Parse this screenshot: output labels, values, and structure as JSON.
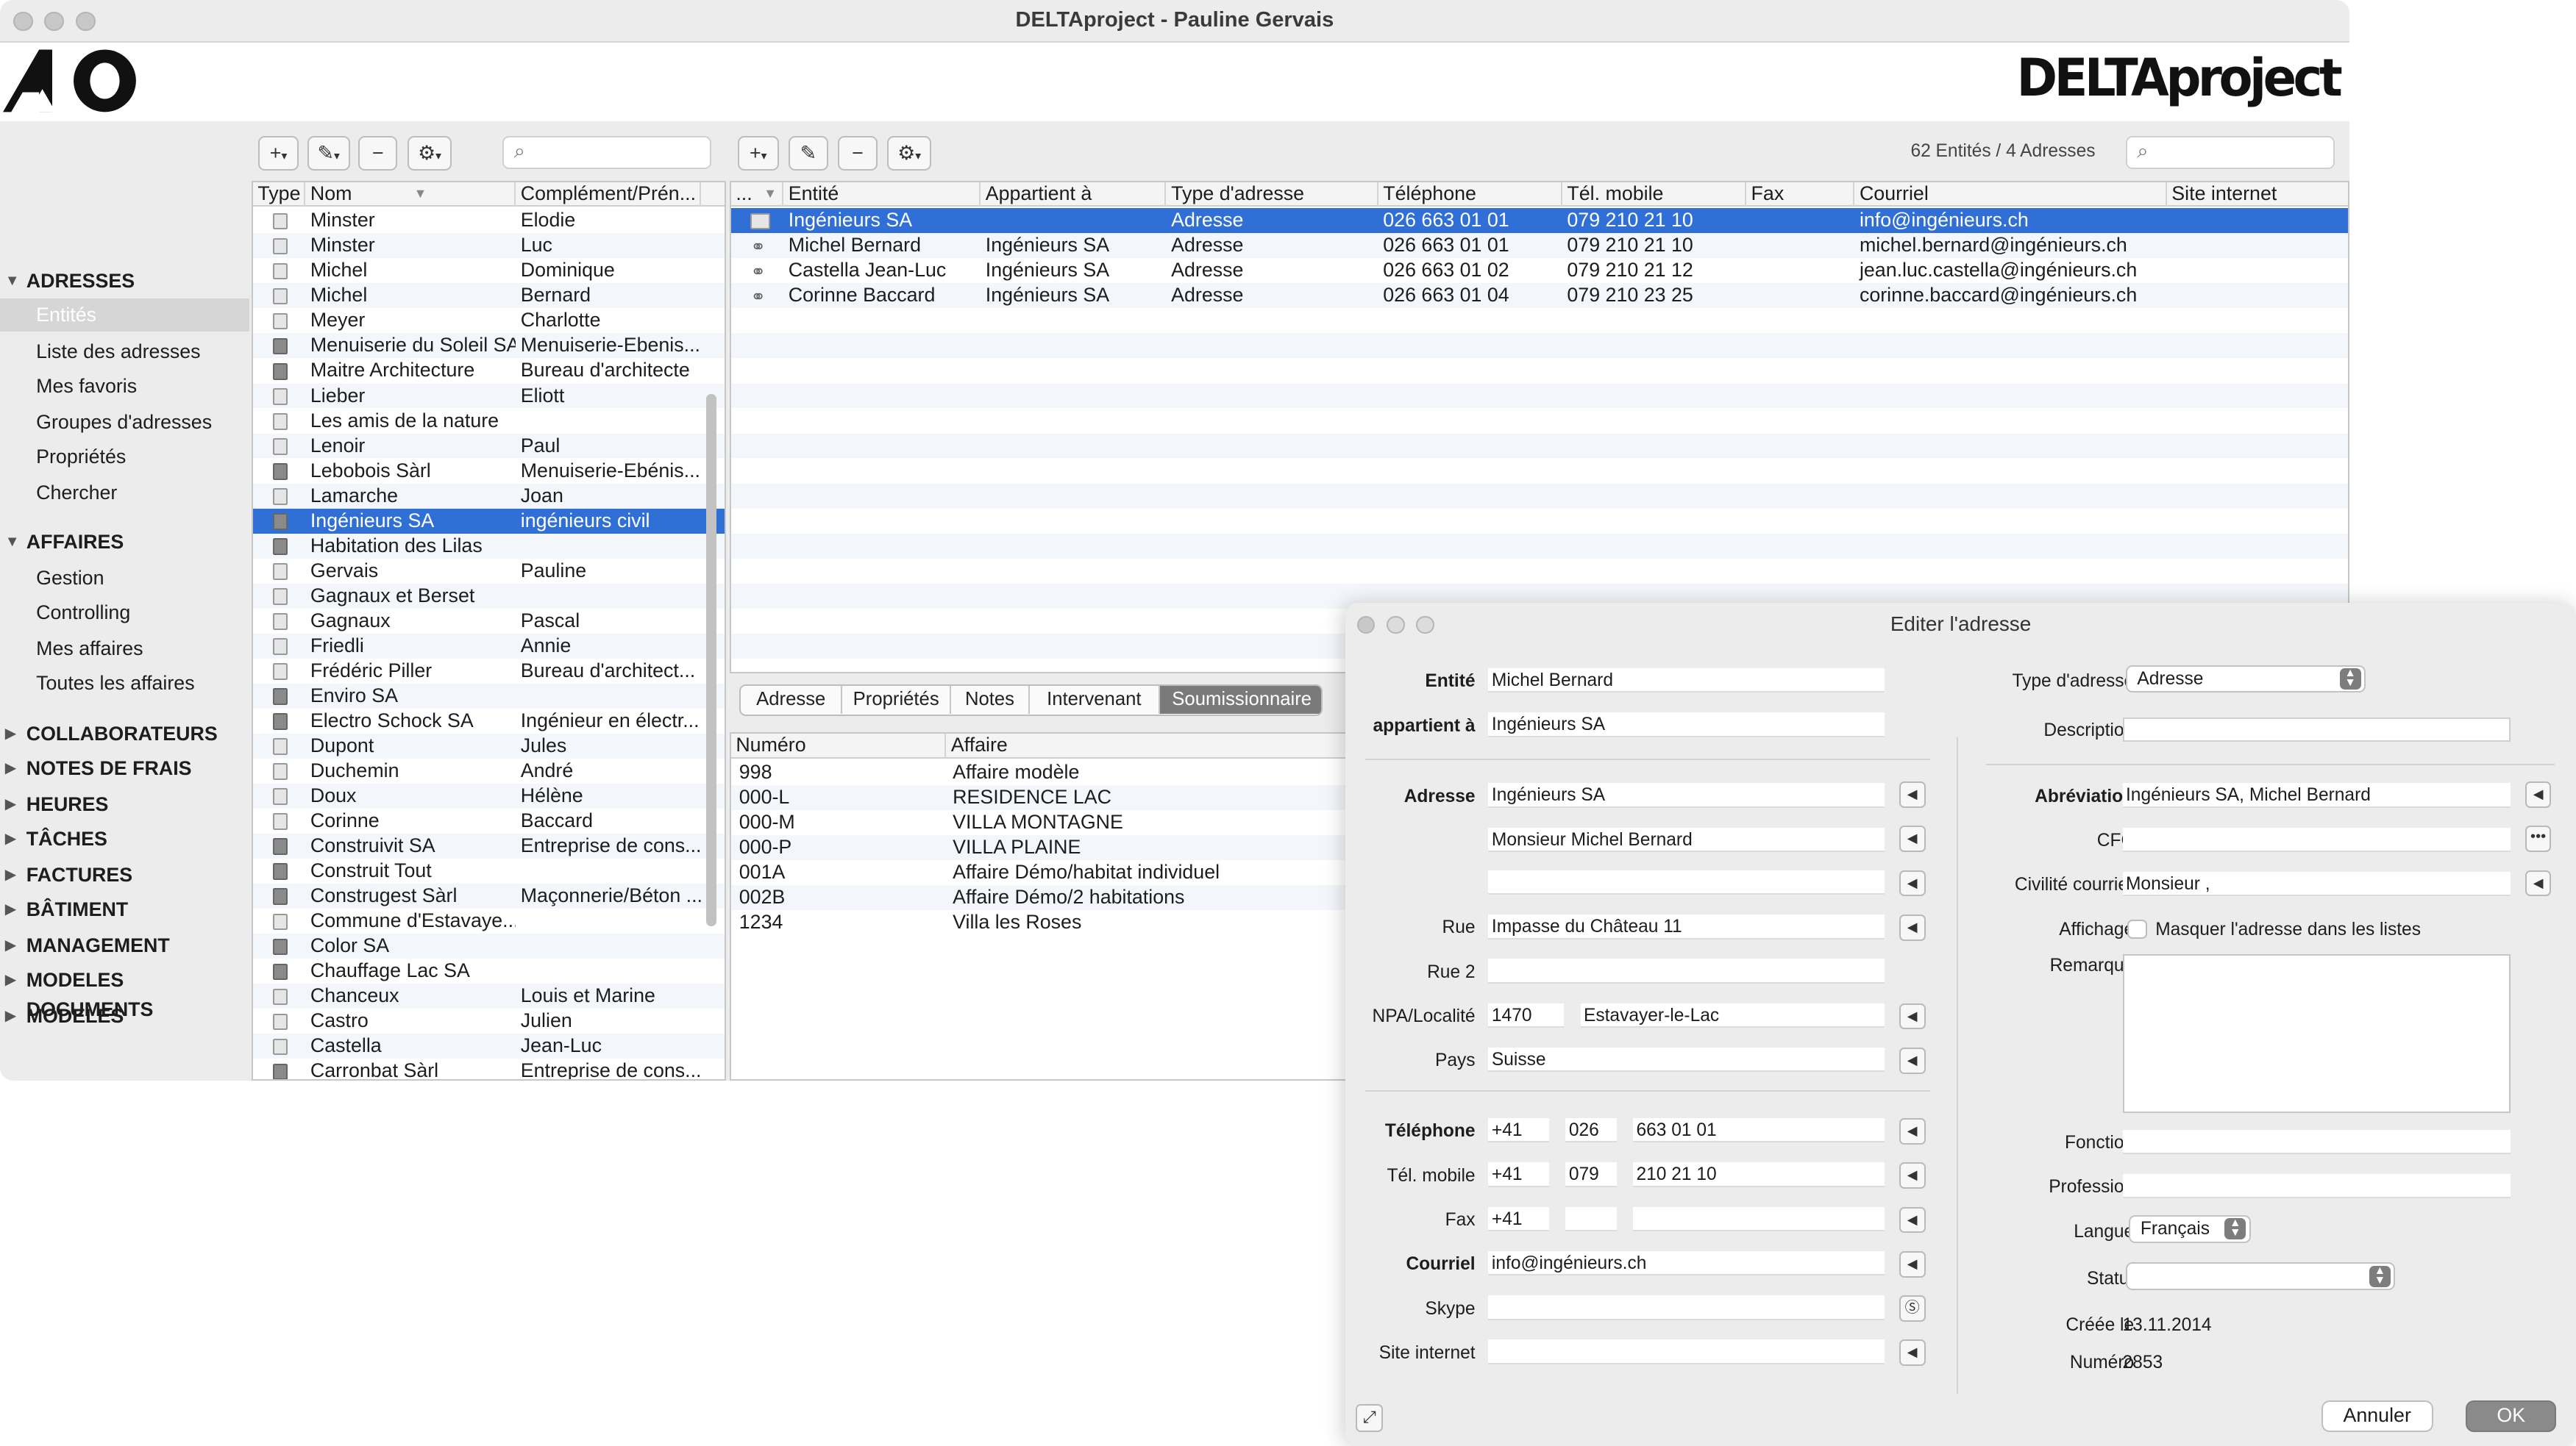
{
  "window": {
    "title": "DELTAproject - Pauline Gervais",
    "brand_right": "DELTAproject"
  },
  "toolbar": {
    "counts": "62 Entités / 4 Adresses",
    "add": "+",
    "edit": "✎",
    "remove": "−",
    "gear": "⚙"
  },
  "sidebar": {
    "adresses": "ADRESSES",
    "adresses_items": [
      "Entités",
      "Liste des adresses",
      "Mes favoris",
      "Groupes d'adresses",
      "Propriétés",
      "Chercher"
    ],
    "affaires": "AFFAIRES",
    "affaires_items": [
      "Gestion",
      "Controlling",
      "Mes affaires",
      "Toutes les affaires"
    ],
    "collapsed": [
      "COLLABORATEURS",
      "NOTES DE FRAIS",
      "HEURES",
      "TÂCHES",
      "FACTURES",
      "BÂTIMENT",
      "MANAGEMENT",
      "MODELES DOCUMENTS",
      "MODELES"
    ]
  },
  "entities": {
    "columns": [
      "Type",
      "Nom",
      "Complément/Prén..."
    ],
    "rows": [
      {
        "type": "person",
        "nom": "Minster",
        "comp": "Elodie"
      },
      {
        "type": "person",
        "nom": "Minster",
        "comp": "Luc"
      },
      {
        "type": "person",
        "nom": "Michel",
        "comp": "Dominique"
      },
      {
        "type": "person",
        "nom": "Michel",
        "comp": "Bernard"
      },
      {
        "type": "person",
        "nom": "Meyer",
        "comp": "Charlotte"
      },
      {
        "type": "company",
        "nom": "Menuiserie du Soleil SA",
        "comp": "Menuiserie-Ebenis..."
      },
      {
        "type": "company",
        "nom": "Maitre Architecture",
        "comp": "Bureau d'architecte"
      },
      {
        "type": "person",
        "nom": "Lieber",
        "comp": "Eliott"
      },
      {
        "type": "group",
        "nom": "Les amis de la nature",
        "comp": ""
      },
      {
        "type": "person",
        "nom": "Lenoir",
        "comp": "Paul"
      },
      {
        "type": "company",
        "nom": "Lebobois Sàrl",
        "comp": "Menuiserie-Ebénis..."
      },
      {
        "type": "person",
        "nom": "Lamarche",
        "comp": "Joan"
      },
      {
        "type": "company",
        "nom": "Ingénieurs SA",
        "comp": "ingénieurs civil"
      },
      {
        "type": "company",
        "nom": "Habitation des Lilas",
        "comp": ""
      },
      {
        "type": "person",
        "nom": "Gervais",
        "comp": "Pauline"
      },
      {
        "type": "group",
        "nom": "Gagnaux et Berset",
        "comp": ""
      },
      {
        "type": "person",
        "nom": "Gagnaux",
        "comp": "Pascal"
      },
      {
        "type": "person",
        "nom": "Friedli",
        "comp": "Annie"
      },
      {
        "type": "person",
        "nom": "Frédéric Piller",
        "comp": "Bureau d'architect..."
      },
      {
        "type": "company",
        "nom": "Enviro SA",
        "comp": ""
      },
      {
        "type": "company",
        "nom": "Electro Schock SA",
        "comp": "Ingénieur en électr..."
      },
      {
        "type": "person",
        "nom": "Dupont",
        "comp": "Jules"
      },
      {
        "type": "person",
        "nom": "Duchemin",
        "comp": "André"
      },
      {
        "type": "person",
        "nom": "Doux",
        "comp": "Hélène"
      },
      {
        "type": "person",
        "nom": "Corinne",
        "comp": "Baccard"
      },
      {
        "type": "company",
        "nom": "Construivit SA",
        "comp": "Entreprise de cons..."
      },
      {
        "type": "company",
        "nom": "Construit Tout",
        "comp": ""
      },
      {
        "type": "company",
        "nom": "Construgest Sàrl",
        "comp": "Maçonnerie/Béton ..."
      },
      {
        "type": "group",
        "nom": "Commune d'Estavaye...",
        "comp": ""
      },
      {
        "type": "company",
        "nom": "Color SA",
        "comp": ""
      },
      {
        "type": "company",
        "nom": "Chauffage Lac SA",
        "comp": ""
      },
      {
        "type": "group",
        "nom": "Chanceux",
        "comp": "Louis et Marine"
      },
      {
        "type": "person",
        "nom": "Castro",
        "comp": "Julien"
      },
      {
        "type": "person",
        "nom": "Castella",
        "comp": "Jean-Luc"
      },
      {
        "type": "company",
        "nom": "Carronbat Sàrl",
        "comp": "Entreprise de cons..."
      }
    ]
  },
  "addresses": {
    "columns": [
      "...",
      "Entité",
      "Appartient à",
      "Type d'adresse",
      "Téléphone",
      "Tél. mobile",
      "Fax",
      "Courriel",
      "Site internet"
    ],
    "rows": [
      {
        "entite": "Ingénieurs SA",
        "appartient": "",
        "type": "Adresse",
        "tel": "026 663 01 01",
        "mobile": "079 210 21 10",
        "fax": "",
        "courriel": "info@ingénieurs.ch",
        "site": ""
      },
      {
        "entite": "Michel Bernard",
        "appartient": "Ingénieurs SA",
        "type": "Adresse",
        "tel": "026 663 01 01",
        "mobile": "079 210 21 10",
        "fax": "",
        "courriel": "michel.bernard@ingénieurs.ch",
        "site": ""
      },
      {
        "entite": "Castella Jean-Luc",
        "appartient": "Ingénieurs SA",
        "type": "Adresse",
        "tel": "026 663 01 02",
        "mobile": "079 210 21 12",
        "fax": "",
        "courriel": "jean.luc.castella@ingénieurs.ch",
        "site": ""
      },
      {
        "entite": "Corinne Baccard",
        "appartient": "Ingénieurs SA",
        "type": "Adresse",
        "tel": "026 663 01 04",
        "mobile": "079 210 23 25",
        "fax": "",
        "courriel": "corinne.baccard@ingénieurs.ch",
        "site": ""
      }
    ]
  },
  "tabs": [
    "Adresse",
    "Propriétés",
    "Notes",
    "Intervenant",
    "Soumissionnaire"
  ],
  "affaires_table": {
    "columns": [
      "Numéro",
      "Affaire"
    ],
    "rows": [
      {
        "num": "998",
        "affaire": "Affaire modèle"
      },
      {
        "num": "000-L",
        "affaire": "RESIDENCE LAC"
      },
      {
        "num": "000-M",
        "affaire": "VILLA MONTAGNE"
      },
      {
        "num": "000-P",
        "affaire": "VILLA PLAINE"
      },
      {
        "num": "001A",
        "affaire": "Affaire Démo/habitat individuel"
      },
      {
        "num": "002B",
        "affaire": "Affaire Démo/2 habitations"
      },
      {
        "num": "1234",
        "affaire": "Villa les Roses"
      }
    ]
  },
  "dialog": {
    "title": "Editer l'adresse",
    "labels": {
      "entite": "Entité",
      "appartient": "appartient à",
      "adresse": "Adresse",
      "rue": "Rue",
      "rue2": "Rue 2",
      "npa": "NPA/Localité",
      "pays": "Pays",
      "telephone": "Téléphone",
      "mobile": "Tél. mobile",
      "fax": "Fax",
      "courriel": "Courriel",
      "skype": "Skype",
      "site": "Site internet",
      "type_adresse": "Type d'adresse",
      "description": "Description",
      "abreviation": "Abréviation",
      "cfc": "CFC",
      "civilite": "Civilité courrier",
      "affichage": "Affichage",
      "remarque": "Remarque",
      "fonction": "Fonction",
      "profession": "Profession",
      "langue": "Langue",
      "statut": "Statut",
      "creee": "Créée le",
      "numero": "Numéro"
    },
    "values": {
      "entite": "Michel Bernard",
      "appartient": "Ingénieurs SA",
      "adresse1": "Ingénieurs SA",
      "adresse2": "Monsieur Michel Bernard",
      "adresse3": "",
      "rue": "Impasse du Château 11",
      "rue2": "",
      "npa": "1470",
      "localite": "Estavayer-le-Lac",
      "pays": "Suisse",
      "tel_cc": "+41",
      "tel_area": "026",
      "tel_num": "663 01 01",
      "mob_cc": "+41",
      "mob_area": "079",
      "mob_num": "210 21 10",
      "fax_cc": "+41",
      "fax_area": "",
      "fax_num": "",
      "courriel": "info@ingénieurs.ch",
      "skype": "",
      "site": "",
      "type_adresse": "Adresse",
      "description": "",
      "abreviation": "Ingénieurs SA, Michel Bernard",
      "cfc": "",
      "civilite": "Monsieur ,",
      "affichage_label": "Masquer l'adresse dans les listes",
      "fonction": "",
      "profession": "",
      "langue": "Français",
      "statut": "",
      "creee": "13.11.2014",
      "numero": "2853"
    },
    "buttons": {
      "cancel": "Annuler",
      "ok": "OK"
    }
  }
}
